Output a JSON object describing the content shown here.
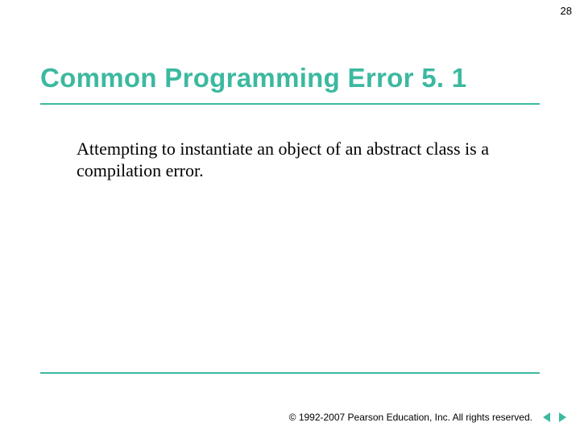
{
  "page": {
    "number": "28"
  },
  "slide": {
    "title": "Common Programming Error 5. 1",
    "body": "Attempting to instantiate an object of an abstract class is a compilation error."
  },
  "footer": {
    "copyright": "© 1992-2007 Pearson Education, Inc.  All rights reserved."
  },
  "colors": {
    "accent": "#3cb9a0"
  }
}
